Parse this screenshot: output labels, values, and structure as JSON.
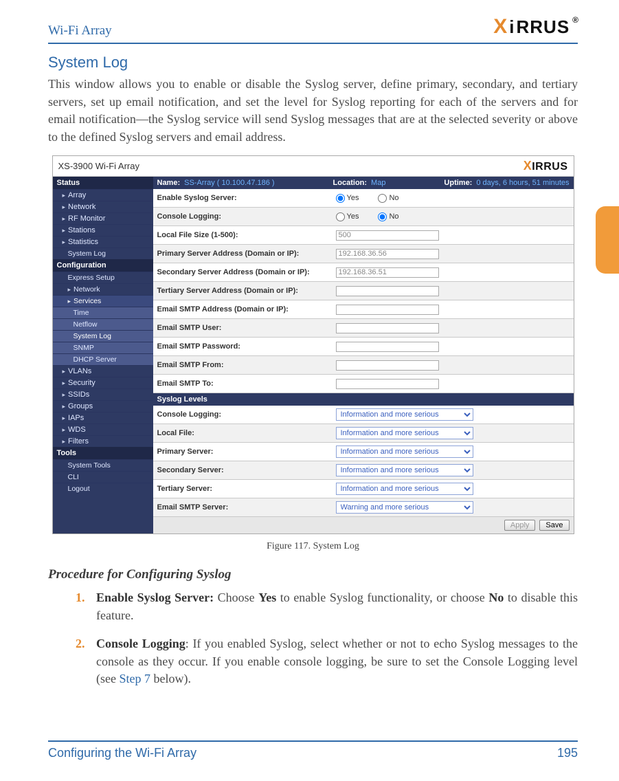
{
  "header": {
    "title": "Wi-Fi Array",
    "brand_pre": "X",
    "brand_mid": "i",
    "brand_post": "RRUS",
    "reg": "®"
  },
  "section_title": "System Log",
  "intro": "This window allows you to enable or disable the Syslog server, define primary, secondary, and tertiary servers, set up email notification, and set the level for Syslog reporting for each of the servers and for email notification—the Syslog service will send Syslog messages that are at the selected severity or above to the defined Syslog servers and email address.",
  "caption": "Figure 117. System Log",
  "proc_heading": "Procedure for Configuring Syslog",
  "steps": [
    {
      "n": "1.",
      "lead": "Enable Syslog Server:",
      "rest1": " Choose ",
      "bold1": "Yes",
      "rest2": " to enable Syslog functionality, or choose ",
      "bold2": "No",
      "rest3": " to disable this feature."
    },
    {
      "n": "2.",
      "lead": "Console Logging",
      "rest1": ": If you enabled Syslog, select whether or not to echo Syslog messages to the console as they occur. If you enable console logging, be sure to set the Console Logging level (see ",
      "link": "Step 7",
      "rest2": " below)."
    }
  ],
  "footer": {
    "left": "Configuring the Wi-Fi Array",
    "right": "195"
  },
  "shot": {
    "window_title": "XS-3900 Wi-Fi Array",
    "topbar": {
      "name_label": "Name:",
      "name_value": "SS-Array   ( 10.100.47.186 )",
      "loc_label": "Location:",
      "loc_value": "Map",
      "uptime_label": "Uptime:",
      "uptime_value": "0 days, 6 hours, 51 minutes"
    },
    "sidebar": {
      "s1": "Status",
      "items1": [
        "Array",
        "Network",
        "RF Monitor",
        "Stations",
        "Statistics",
        "System Log"
      ],
      "s2": "Configuration",
      "items2": [
        "Express Setup",
        "Network",
        "Services"
      ],
      "services_sub": [
        "Time",
        "Netflow",
        "System Log",
        "SNMP",
        "DHCP Server"
      ],
      "items2b": [
        "VLANs",
        "Security",
        "SSIDs",
        "Groups",
        "IAPs",
        "WDS",
        "Filters"
      ],
      "s3": "Tools",
      "items3": [
        "System Tools",
        "CLI",
        "Logout"
      ]
    },
    "rows": [
      {
        "label": "Enable Syslog Server:",
        "type": "radio",
        "yes": "Yes",
        "no": "No",
        "checked": "yes"
      },
      {
        "label": "Console Logging:",
        "type": "radio",
        "yes": "Yes",
        "no": "No",
        "checked": "no"
      },
      {
        "label": "Local File Size (1-500):",
        "type": "text",
        "value": "500"
      },
      {
        "label": "Primary Server Address (Domain or IP):",
        "type": "text",
        "value": "192.168.36.56"
      },
      {
        "label": "Secondary Server Address (Domain or IP):",
        "type": "text",
        "value": "192.168.36.51"
      },
      {
        "label": "Tertiary Server Address (Domain or IP):",
        "type": "text",
        "value": ""
      },
      {
        "label": "Email SMTP Address (Domain or IP):",
        "type": "text",
        "value": ""
      },
      {
        "label": "Email SMTP User:",
        "type": "text",
        "value": ""
      },
      {
        "label": "Email SMTP Password:",
        "type": "text",
        "value": ""
      },
      {
        "label": "Email SMTP From:",
        "type": "text",
        "value": ""
      },
      {
        "label": "Email SMTP To:",
        "type": "text",
        "value": ""
      }
    ],
    "levels_title": "Syslog Levels",
    "levels": [
      {
        "label": "Console Logging:",
        "value": "Information and more serious"
      },
      {
        "label": "Local File:",
        "value": "Information and more serious"
      },
      {
        "label": "Primary Server:",
        "value": "Information and more serious"
      },
      {
        "label": "Secondary Server:",
        "value": "Information and more serious"
      },
      {
        "label": "Tertiary Server:",
        "value": "Information and more serious"
      },
      {
        "label": "Email SMTP Server:",
        "value": "Warning and more serious"
      }
    ],
    "buttons": {
      "apply": "Apply",
      "save": "Save"
    }
  }
}
